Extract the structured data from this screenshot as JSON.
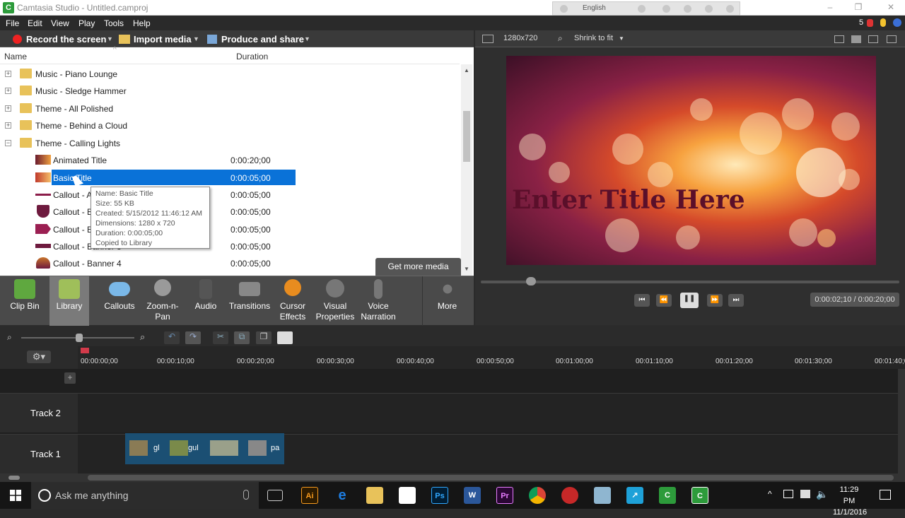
{
  "window": {
    "title": "Camtasia Studio - Untitled.camproj",
    "app_icon": "C",
    "language": "English"
  },
  "menu": [
    "File",
    "Edit",
    "View",
    "Play",
    "Tools",
    "Help"
  ],
  "menu_right": {
    "count": "5"
  },
  "toolbar": {
    "record": "Record the screen",
    "import": "Import media",
    "produce": "Produce and share"
  },
  "library": {
    "col_name": "Name",
    "col_duration": "Duration",
    "rows": [
      {
        "label": "Music - Piano Lounge",
        "duration": ""
      },
      {
        "label": "Music - Sledge Hammer",
        "duration": ""
      },
      {
        "label": "Theme - All Polished",
        "duration": ""
      },
      {
        "label": "Theme - Behind a Cloud",
        "duration": ""
      },
      {
        "label": "Theme - Calling Lights",
        "duration": ""
      },
      {
        "label": "Animated Title",
        "duration": "0:00:20;00"
      },
      {
        "label": "Basic Title",
        "duration": "0:00:05;00"
      },
      {
        "label": "Callout - A",
        "duration": "0:00:05;00"
      },
      {
        "label": "Callout - B",
        "duration": "0:00:05;00"
      },
      {
        "label": "Callout - B",
        "duration": "0:00:05;00"
      },
      {
        "label": "Callout - Banner 3",
        "duration": "0:00:05;00"
      },
      {
        "label": "Callout - Banner 4",
        "duration": "0:00:05;00"
      }
    ],
    "tooltip": [
      "Name: Basic Title",
      "Size: 55 KB",
      "Created: 5/15/2012 11:46:12 AM",
      "Dimensions: 1280 x 720",
      "Duration: 0:00:05;00",
      "Copied to Library"
    ],
    "get_more": "Get more media"
  },
  "tasks": [
    {
      "label": "Clip Bin",
      "icon": "film-icon",
      "color": "#5fa83f"
    },
    {
      "label": "Library",
      "icon": "library-icon",
      "color": "#9fbf5a"
    },
    {
      "label": "Callouts",
      "icon": "speech-bubble-icon",
      "color": "#7ab8e8"
    },
    {
      "label": "Zoom-n-\nPan",
      "icon": "magnifier-icon",
      "color": "#9a9a9a"
    },
    {
      "label": "Audio",
      "icon": "speaker-icon",
      "color": "#555"
    },
    {
      "label": "Transitions",
      "icon": "transition-icon",
      "color": "#888"
    },
    {
      "label": "Cursor\nEffects",
      "icon": "cursor-icon",
      "color": "#e88c1f"
    },
    {
      "label": "Visual\nProperties",
      "icon": "dial-icon",
      "color": "#777"
    },
    {
      "label": "Voice\nNarration",
      "icon": "microphone-icon",
      "color": "#777"
    },
    {
      "label": "More",
      "icon": "dots-icon",
      "color": "#666"
    }
  ],
  "preview": {
    "resolution": "1280x720",
    "zoom": "Shrink to fit",
    "title_text": "Enter Title Here",
    "timecode": "0:00:02;10 / 0:00:20;00",
    "position_fraction": 0.12
  },
  "timeline": {
    "ticks": [
      "00:00:00;00",
      "00:00:10;00",
      "00:00:20;00",
      "00:00:30;00",
      "00:00:40;00",
      "00:00:50;00",
      "00:01:00;00",
      "00:01:10;00",
      "00:01:20;00",
      "00:01:30;00",
      "00:01:40;00"
    ],
    "tracks": [
      "Track 2",
      "Track 1"
    ],
    "clips": [
      "gl",
      "gul",
      "",
      "pa"
    ]
  },
  "taskbar": {
    "search": "Ask me anything",
    "time": "11:29 PM",
    "date": "11/1/2016"
  }
}
